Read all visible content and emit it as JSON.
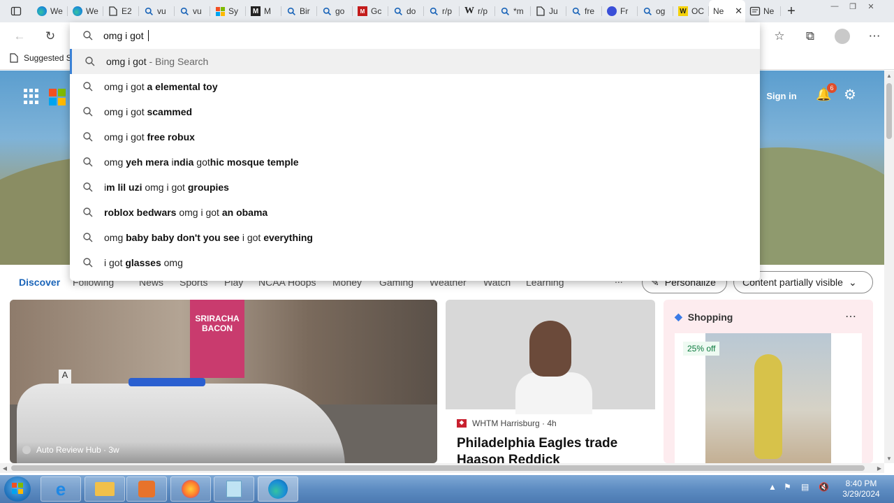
{
  "tabs": [
    {
      "label": "We",
      "icon": "edge-icon"
    },
    {
      "label": "We",
      "icon": "edge-icon"
    },
    {
      "label": "E2",
      "icon": "document-icon"
    },
    {
      "label": "vu",
      "icon": "search-icon"
    },
    {
      "label": "vu",
      "icon": "search-icon"
    },
    {
      "label": "Sy",
      "icon": "microsoft-icon"
    },
    {
      "label": "M",
      "icon": "m-logo-icon"
    },
    {
      "label": "Bir",
      "icon": "search-icon"
    },
    {
      "label": "go",
      "icon": "search-icon"
    },
    {
      "label": "Gc",
      "icon": "mc-logo-icon"
    },
    {
      "label": "do",
      "icon": "search-icon"
    },
    {
      "label": "r/p",
      "icon": "search-icon"
    },
    {
      "label": "r/p",
      "icon": "wikipedia-icon"
    },
    {
      "label": "*m",
      "icon": "search-icon"
    },
    {
      "label": "Ju",
      "icon": "document-icon"
    },
    {
      "label": "fre",
      "icon": "search-icon"
    },
    {
      "label": "Fr",
      "icon": "copilot-icon"
    },
    {
      "label": "og",
      "icon": "search-icon"
    },
    {
      "label": "OC",
      "icon": "w-logo-icon"
    }
  ],
  "active_tab": {
    "label": "Ne"
  },
  "last_tab": {
    "label": "Ne"
  },
  "omnibox": {
    "query": "omg i got ",
    "suggestions": [
      {
        "parts": [
          {
            "t": "omg i got",
            "b": false
          },
          {
            "t": " - Bing Search",
            "m": true
          }
        ]
      },
      {
        "parts": [
          {
            "t": "omg i got ",
            "b": false
          },
          {
            "t": "a elemental toy",
            "b": true
          }
        ]
      },
      {
        "parts": [
          {
            "t": "omg i got ",
            "b": false
          },
          {
            "t": "scammed",
            "b": true
          }
        ]
      },
      {
        "parts": [
          {
            "t": "omg i got ",
            "b": false
          },
          {
            "t": "free robux",
            "b": true
          }
        ]
      },
      {
        "parts": [
          {
            "t": "omg ",
            "b": false
          },
          {
            "t": "yeh mera ",
            "b": true
          },
          {
            "t": "i",
            "b": false
          },
          {
            "t": "ndia ",
            "b": true
          },
          {
            "t": "got",
            "b": false
          },
          {
            "t": "hic mosque temple",
            "b": true
          }
        ]
      },
      {
        "parts": [
          {
            "t": "i",
            "b": false
          },
          {
            "t": "m lil uzi ",
            "b": true
          },
          {
            "t": "omg i got ",
            "b": false
          },
          {
            "t": "groupies",
            "b": true
          }
        ]
      },
      {
        "parts": [
          {
            "t": "roblox bedwars ",
            "b": true
          },
          {
            "t": "omg i got ",
            "b": false
          },
          {
            "t": "an obama",
            "b": true
          }
        ]
      },
      {
        "parts": [
          {
            "t": "omg ",
            "b": false
          },
          {
            "t": "baby baby don't you see ",
            "b": true
          },
          {
            "t": "i got ",
            "b": false
          },
          {
            "t": "everything",
            "b": true
          }
        ]
      },
      {
        "parts": [
          {
            "t": "i got ",
            "b": false
          },
          {
            "t": "glasses",
            "b": true
          },
          {
            "t": " omg",
            "b": false
          }
        ]
      }
    ]
  },
  "favorites_bar": {
    "item": "Suggested S"
  },
  "hero": {
    "signin": "Sign in",
    "notifications": "6"
  },
  "feed_nav": {
    "items": [
      "Discover",
      "Following",
      "News",
      "Sports",
      "Play",
      "NCAA Hoops",
      "Money",
      "Gaming",
      "Weather",
      "Watch",
      "Learning"
    ],
    "more": "...",
    "personalize": "Personalize",
    "content_visibility": "Content partially visible"
  },
  "cards": {
    "big": {
      "source": "Auto Review Hub · 3w",
      "poster": "SRIRACHA BACON",
      "sign": "A"
    },
    "eagles": {
      "source": "WHTM Harrisburg · 4h",
      "headline": "Philadelphia Eagles trade Haason Reddick"
    },
    "shopping": {
      "title": "Shopping",
      "discount": "25% off"
    }
  },
  "clock": {
    "time": "8:40 PM",
    "date": "3/29/2024"
  },
  "colors": {
    "accent": "#1a64b8",
    "badge": "#e04d2a",
    "taskbar": "#5d8cc2"
  }
}
